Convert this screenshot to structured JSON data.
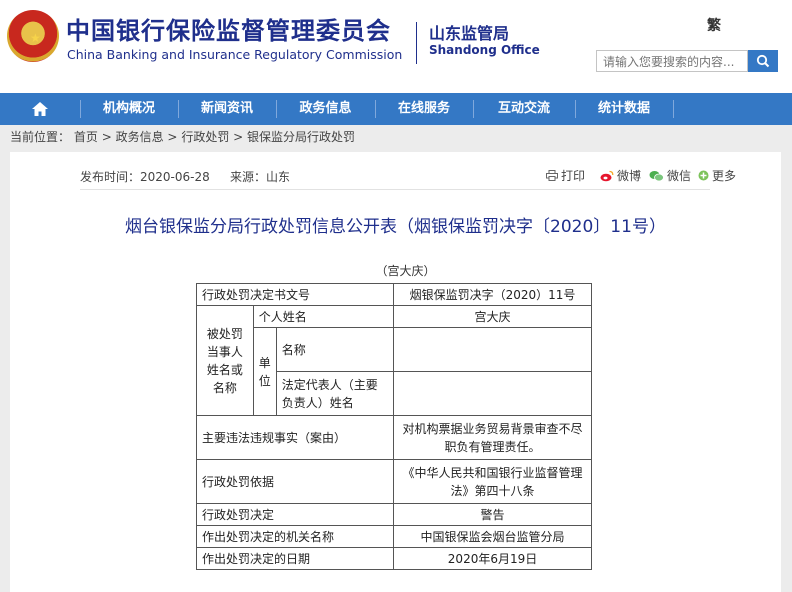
{
  "header": {
    "title_cn": "中国银行保险监督管理委员会",
    "title_en": "China Banking and Insurance Regulatory Commission",
    "office_cn": "山东监管局",
    "office_en": "Shandong Office",
    "traditional_label": "繁",
    "search_placeholder": "请输入您要搜索的内容..."
  },
  "nav": {
    "items": [
      "机构概况",
      "新闻资讯",
      "政务信息",
      "在线服务",
      "互动交流",
      "统计数据"
    ]
  },
  "breadcrumb": {
    "label": "当前位置：",
    "items": [
      "首页",
      "政务信息",
      "行政处罚",
      "银保监分局行政处罚"
    ]
  },
  "article": {
    "publish_time": "发布时间：2020-06-28",
    "source": "来源：山东",
    "share": {
      "print": "打印",
      "weibo": "微博",
      "wechat": "微信",
      "more": "更多"
    },
    "title": "烟台银保监分局行政处罚信息公开表（烟银保监罚决字〔2020〕11号）",
    "subject_name": "（宫大庆）"
  },
  "table": {
    "decision_no_label": "行政处罚决定书文号",
    "decision_no_value": "烟银保监罚决字（2020）11号",
    "party_label": "被处罚当事人姓名或名称",
    "individual_label": "个人姓名",
    "individual_value": "宫大庆",
    "unit_label": "单位",
    "unit_name_label": "名称",
    "unit_name_value": "",
    "legal_rep_label": "法定代表人（主要负责人）姓名",
    "legal_rep_value": "",
    "facts_label": "主要违法违规事实（案由）",
    "facts_value": "对机构票据业务贸易背景审查不尽职负有管理责任。",
    "basis_label": "行政处罚依据",
    "basis_value": "《中华人民共和国银行业监督管理法》第四十八条",
    "decision_label": "行政处罚决定",
    "decision_value": "警告",
    "authority_label": "作出处罚决定的机关名称",
    "authority_value": "中国银保监会烟台监管分局",
    "date_label": "作出处罚决定的日期",
    "date_value": "2020年6月19日"
  },
  "colors": {
    "brand_blue": "#3478c5",
    "title_navy": "#1f2f8c"
  }
}
